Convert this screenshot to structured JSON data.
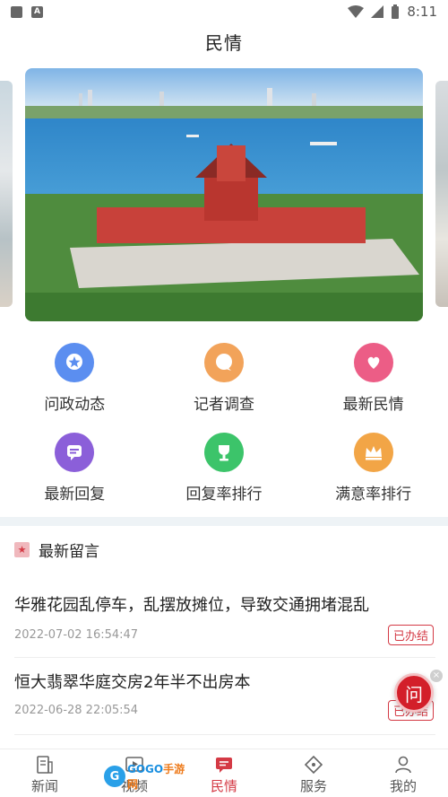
{
  "status_bar": {
    "time": "8:11"
  },
  "header": {
    "title": "民情"
  },
  "grid": [
    {
      "label": "问政动态",
      "icon": "star-bubble-icon",
      "color": "#5b8ef0"
    },
    {
      "label": "记者调查",
      "icon": "chat-bubble-icon",
      "color": "#f2a35a"
    },
    {
      "label": "最新民情",
      "icon": "heart-hand-icon",
      "color": "#ec5d86"
    },
    {
      "label": "最新回复",
      "icon": "message-icon",
      "color": "#8b5fd9"
    },
    {
      "label": "回复率排行",
      "icon": "trophy-icon",
      "color": "#3cc46a"
    },
    {
      "label": "满意率排行",
      "icon": "crown-icon",
      "color": "#f2a546"
    }
  ],
  "latest": {
    "title": "最新留言",
    "items": [
      {
        "title": "华雅花园乱停车，乱摆放摊位，导致交通拥堵混乱",
        "time": "2022-07-02 16:54:47",
        "tag": "已办结"
      },
      {
        "title": "恒大翡翠华庭交房2年半不出房本",
        "time": "2022-06-28 22:05:54",
        "tag": "已办结"
      }
    ]
  },
  "floating": {
    "ask_label": "问",
    "close_label": "×"
  },
  "bottom_nav": [
    {
      "label": "新闻",
      "icon": "news-icon",
      "active": false
    },
    {
      "label": "视频",
      "icon": "video-icon",
      "active": false
    },
    {
      "label": "民情",
      "icon": "public-opinion-icon",
      "active": true
    },
    {
      "label": "服务",
      "icon": "service-icon",
      "active": false
    },
    {
      "label": "我的",
      "icon": "profile-icon",
      "active": false
    }
  ],
  "watermark": {
    "text_a": "GOGO",
    "text_b": "手游网"
  }
}
